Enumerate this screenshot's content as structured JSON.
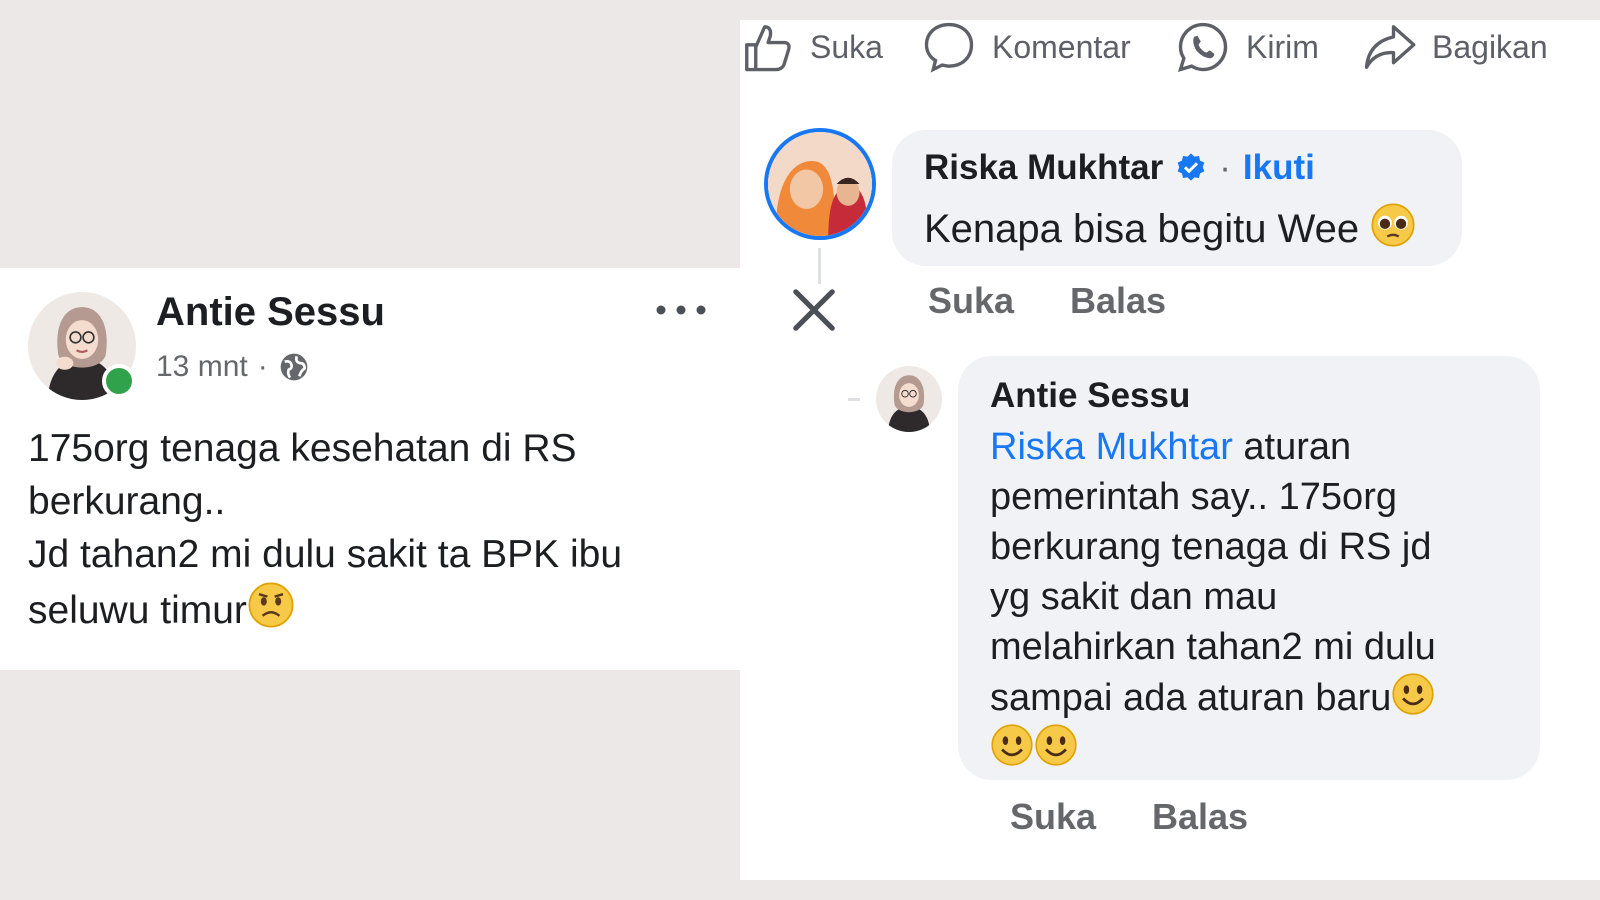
{
  "post": {
    "author": "Antie Sessu",
    "time": "13 mnt",
    "separator": "·",
    "privacy_icon": "globe-icon",
    "more_icon": "more-horizontal-icon",
    "close_icon": "close-icon",
    "lines": [
      "175org tenaga kesehatan di RS",
      "berkurang..",
      "Jd tahan2 mi dulu sakit ta BPK ibu",
      "seluwu timur"
    ],
    "emoji": "worried-face-emoji"
  },
  "actions": [
    {
      "icon": "like-icon",
      "label": "Suka"
    },
    {
      "icon": "comment-icon",
      "label": "Komentar"
    },
    {
      "icon": "whatsapp-icon",
      "label": "Kirim"
    },
    {
      "icon": "share-icon",
      "label": "Bagikan"
    }
  ],
  "comment1": {
    "author": "Riska Mukhtar",
    "verified_icon": "verified-badge-icon",
    "follow_separator": "·",
    "follow_label": "Ikuti",
    "text": "Kenapa bisa begitu Wee",
    "emoji": "pleading-face-emoji",
    "like_label": "Suka",
    "reply_label": "Balas"
  },
  "comment2": {
    "author": "Antie Sessu",
    "mention": "Riska Mukhtar",
    "lines": [
      " aturan",
      "pemerintah say.. 175org",
      "berkurang tenaga di RS jd",
      "yg sakit dan mau",
      "melahirkan tahan2 mi dulu",
      "sampai ada aturan baru"
    ],
    "emoji": "smiling-face-emoji",
    "like_label": "Suka",
    "reply_label": "Balas"
  },
  "colors": {
    "background": "#ebe8e7",
    "link": "#1877f2",
    "online": "#31a24c",
    "bubble": "#f0f2f5",
    "muted": "#65676b"
  }
}
